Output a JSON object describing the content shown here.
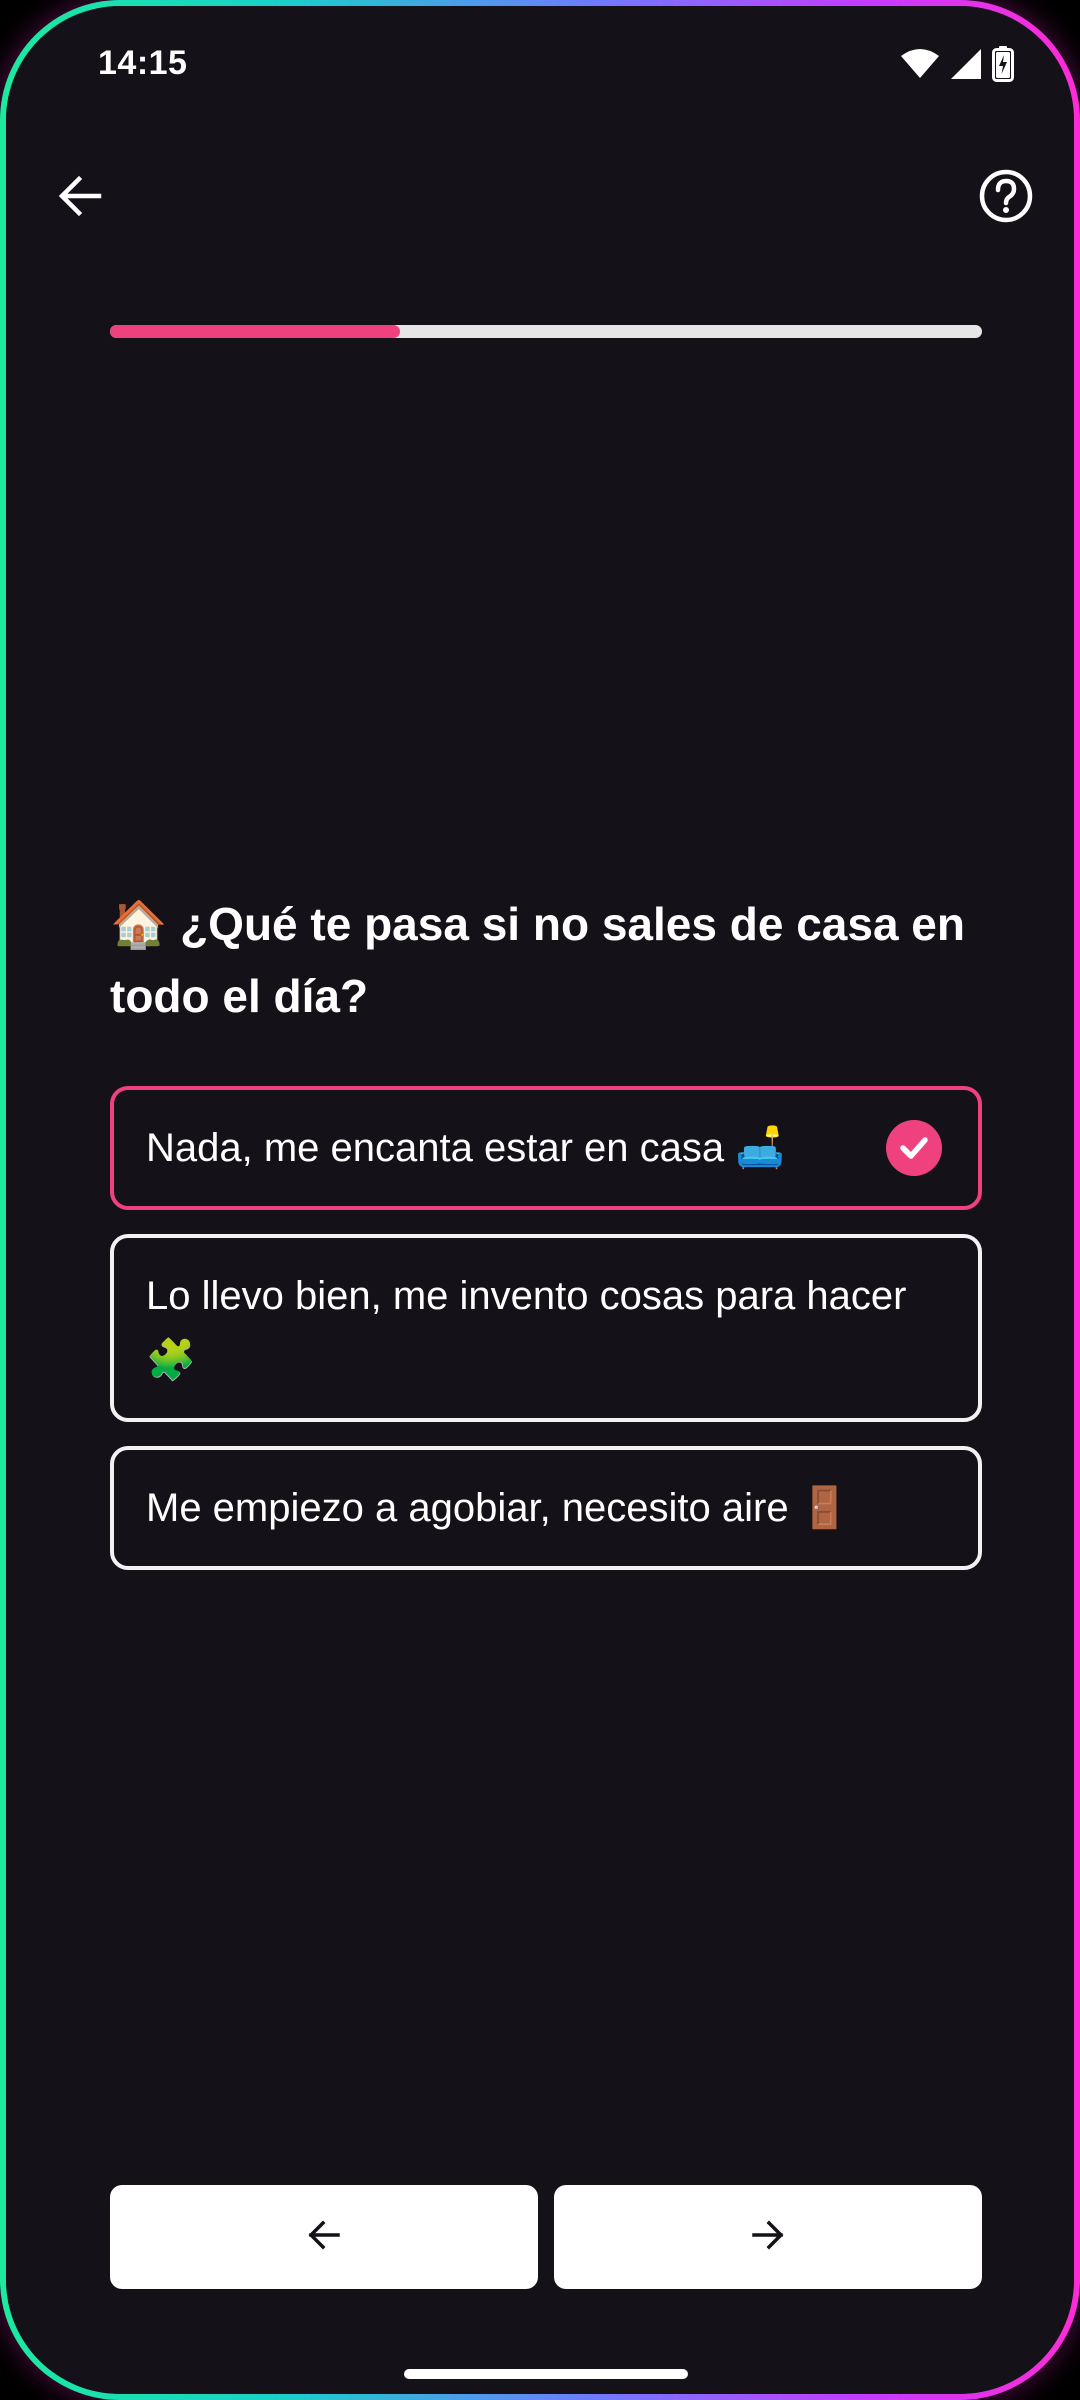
{
  "status_bar": {
    "time": "14:15",
    "icons": [
      "wifi-icon",
      "signal-icon",
      "battery-charging-icon"
    ]
  },
  "top_bar": {
    "back_icon": "arrow-left-icon",
    "help_icon": "help-circle-icon"
  },
  "progress": {
    "value": 0.333
  },
  "question": {
    "emoji": "🏠",
    "text": "¿Qué te pasa si no sales de casa en todo el día?"
  },
  "options": [
    {
      "label": "Nada, me encanta estar en casa 🛋️",
      "selected": true
    },
    {
      "label": "Lo llevo bien, me invento cosas para hacer 🧩",
      "selected": false
    },
    {
      "label": "Me empiezo a agobiar, necesito aire 🚪",
      "selected": false
    }
  ],
  "navigation": {
    "prev_icon": "arrow-left-icon",
    "next_icon": "arrow-right-icon"
  },
  "colors": {
    "background": "#141118",
    "accent": "#f0417f",
    "option_border": "#f2f2f2",
    "track": "#e6e6e6"
  }
}
